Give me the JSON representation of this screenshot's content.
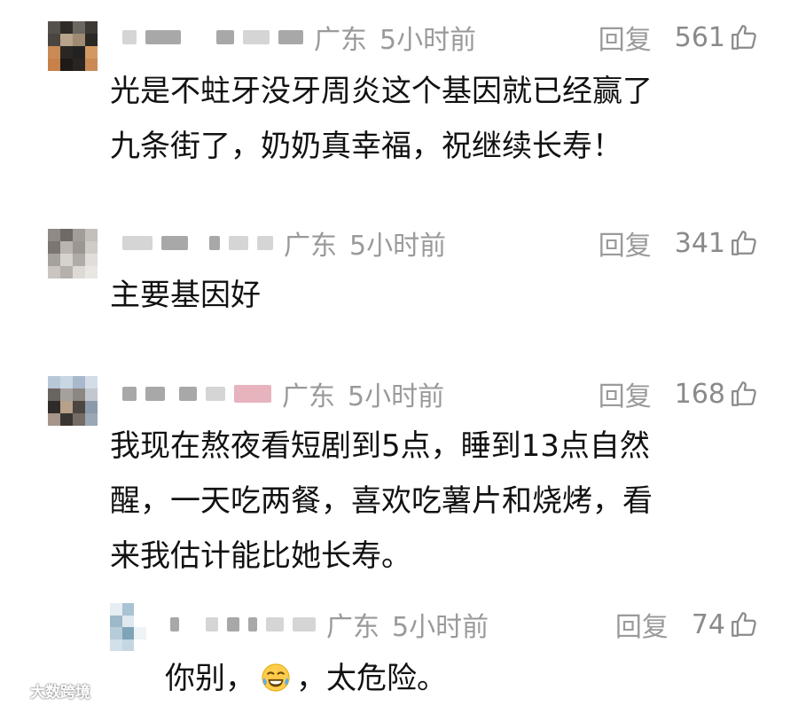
{
  "comments": [
    {
      "region": "广东",
      "time": "5小时前",
      "reply": "回复",
      "likes": "561",
      "lines": [
        "光是不蛀牙没牙周炎这个基因就已经赢了",
        "九条街了，奶奶真幸福，祝继续长寿！"
      ]
    },
    {
      "region": "广东",
      "time": "5小时前",
      "reply": "回复",
      "likes": "341",
      "lines": [
        "主要基因好"
      ]
    },
    {
      "region": "广东",
      "time": "5小时前",
      "reply": "回复",
      "likes": "168",
      "lines": [
        "我现在熬夜看短剧到5点，睡到13点自然",
        "醒，一天吃两餐，喜欢吃薯片和烧烤，看",
        "来我估计能比她长寿。"
      ]
    },
    {
      "region": "广东",
      "time": "5小时前",
      "reply": "回复",
      "likes": "74",
      "text_before": "你别，",
      "emoji": "tears-of-joy-emoji",
      "text_after": "，太危险。"
    }
  ],
  "watermark": "大数跨境",
  "icons": {
    "like": "thumbs-up-outline-icon",
    "watermark": "brand-logo-icon"
  },
  "colors": {
    "meta_gray": "#9a9a9a",
    "text": "#111111",
    "background": "#ffffff"
  }
}
